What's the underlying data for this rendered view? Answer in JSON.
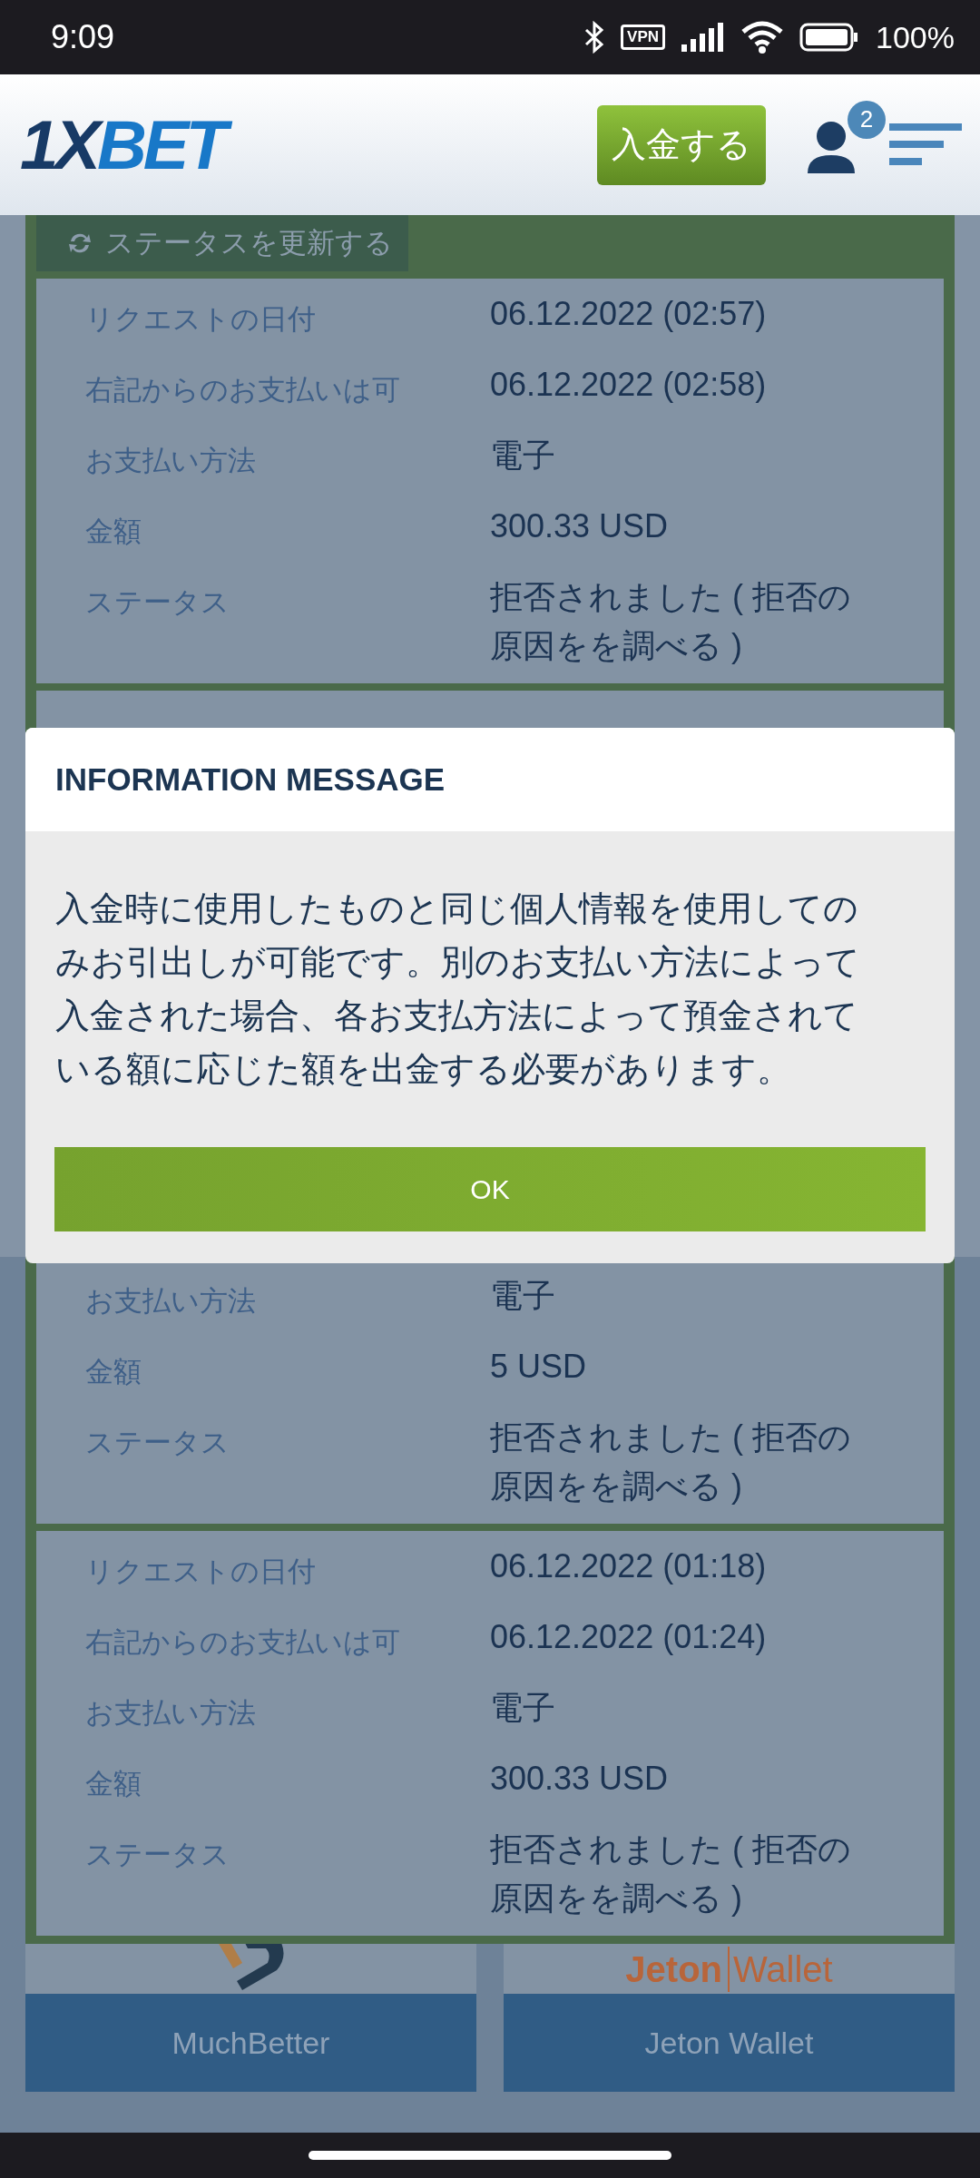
{
  "status_bar": {
    "time": "9:09",
    "vpn": "VPN",
    "battery": "100%"
  },
  "header": {
    "logo": [
      "1X",
      "BET"
    ],
    "deposit_button": "入金する",
    "notification_count": "2"
  },
  "refresh_button": "ステータスを更新する",
  "requests": [
    {
      "rows": [
        {
          "label": "リクエストの日付",
          "value": "06.12.2022 (02:57)"
        },
        {
          "label": "右記からのお支払いは可",
          "value": "06.12.2022 (02:58)"
        },
        {
          "label": "お支払い方法",
          "value": "電子"
        },
        {
          "label": "金額",
          "value": "300.33 USD"
        },
        {
          "label": "ステータス",
          "value": "拒否されました ( 拒否の原因をを調べる )"
        }
      ]
    },
    {
      "rows": [
        {
          "label": "お支払い方法",
          "value": "電子"
        },
        {
          "label": "金額",
          "value": "5 USD"
        },
        {
          "label": "ステータス",
          "value": "拒否されました ( 拒否の原因をを調べる )"
        }
      ]
    },
    {
      "rows": [
        {
          "label": "リクエストの日付",
          "value": "06.12.2022 (01:18)"
        },
        {
          "label": "右記からのお支払いは可",
          "value": "06.12.2022 (01:24)"
        },
        {
          "label": "お支払い方法",
          "value": "電子"
        },
        {
          "label": "金額",
          "value": "300.33 USD"
        },
        {
          "label": "ステータス",
          "value": "拒否されました ( 拒否の原因をを調べる )"
        }
      ]
    }
  ],
  "payment_methods": [
    {
      "kind": "muchbetter",
      "name": "MuchBetter"
    },
    {
      "kind": "jeton",
      "name": "Jeton Wallet",
      "logo": [
        "Jeton",
        "Wallet"
      ]
    }
  ],
  "dialog": {
    "title": "INFORMATION MESSAGE",
    "message": "入金時に使用したものと同じ個人情報を使用してのみお引出しが可能です。別のお支払い方法によって入金された場合、各お支払方法によって預金されている額に応じた額を出金する必要があります。",
    "button": "OK"
  }
}
